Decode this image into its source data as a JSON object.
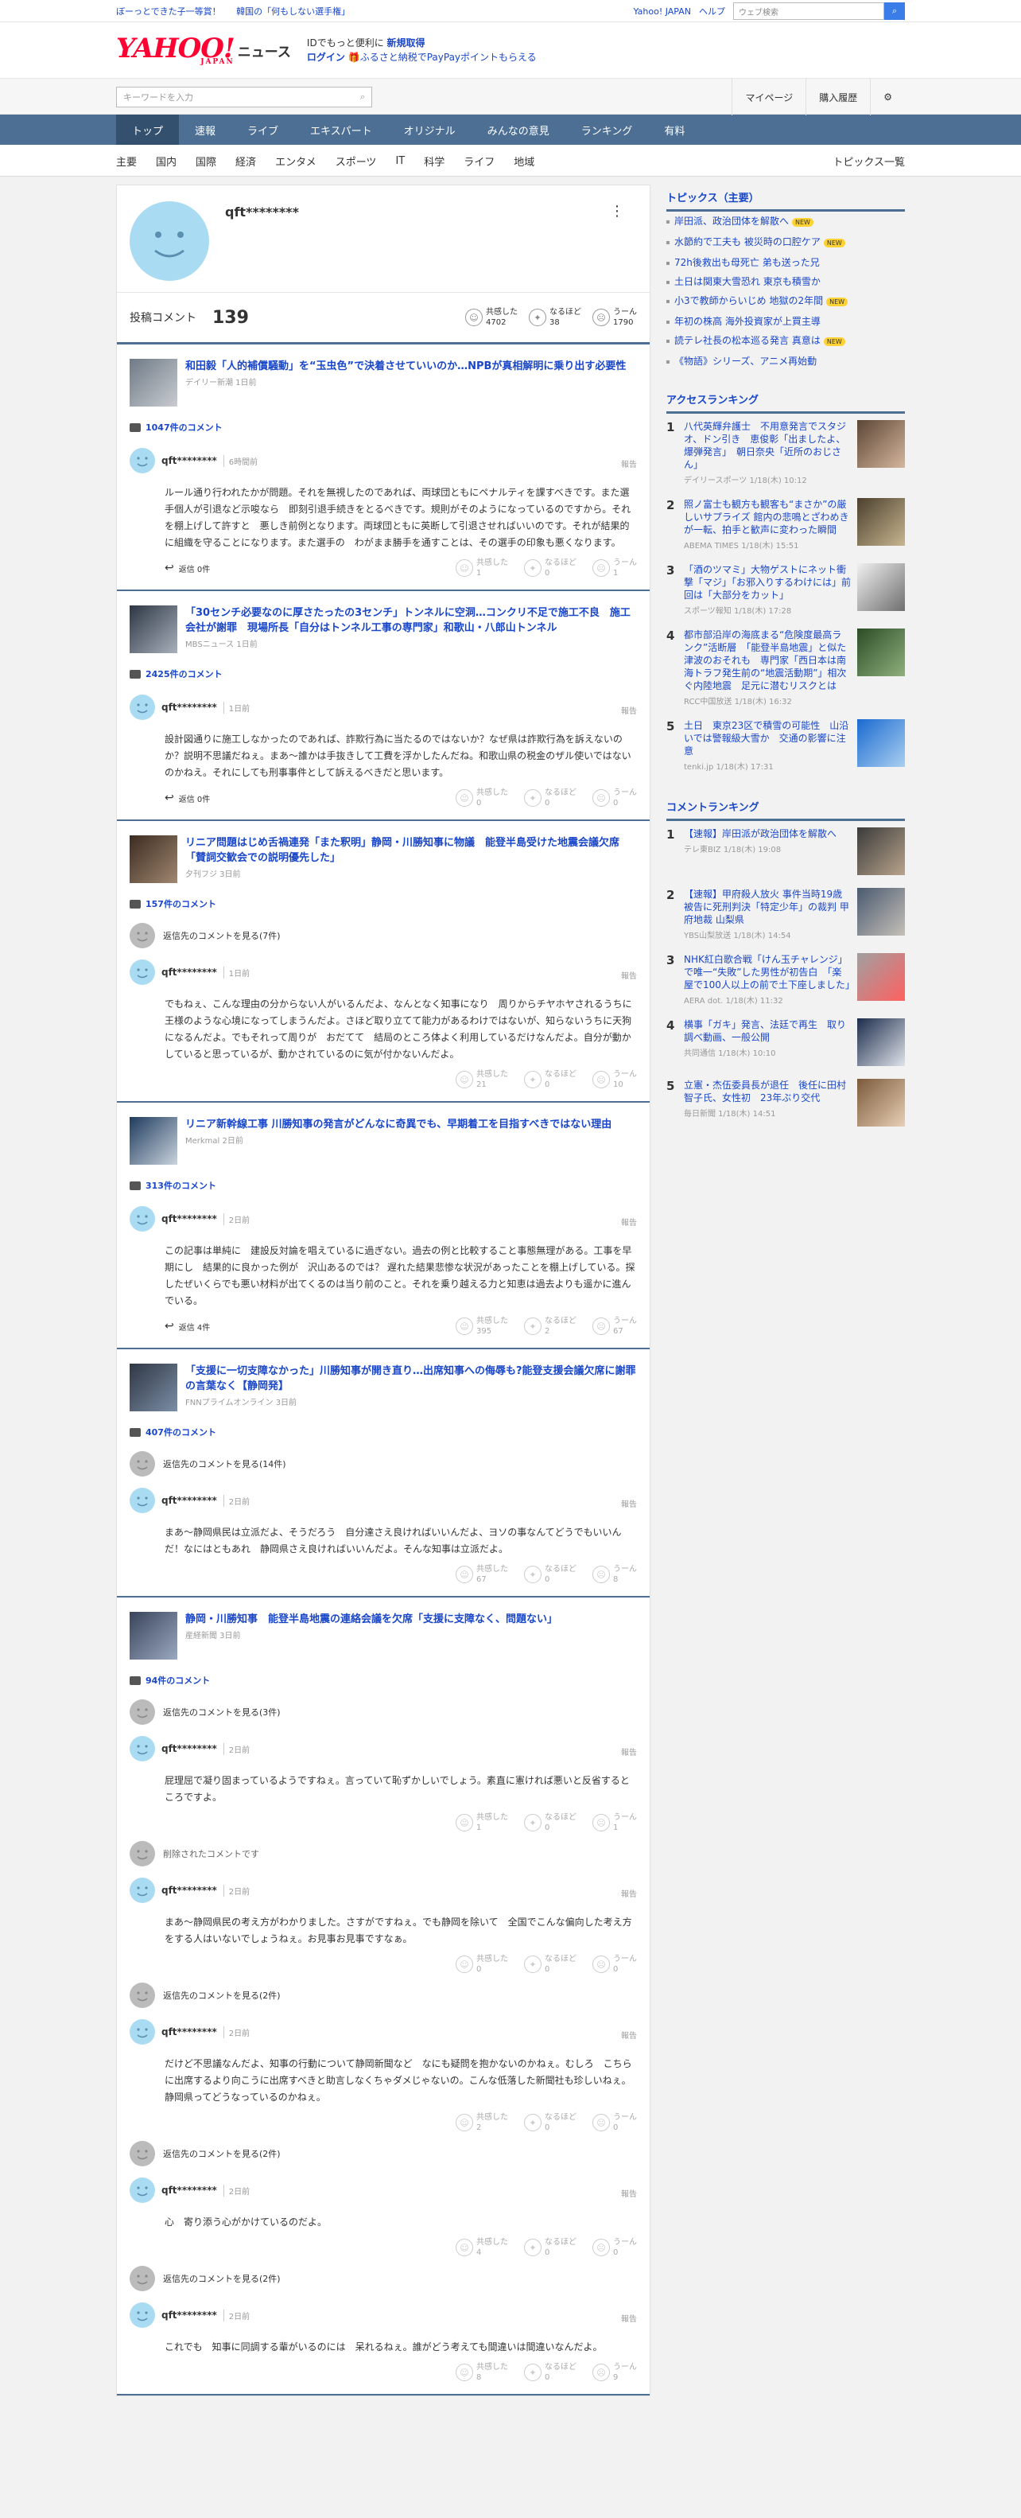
{
  "topbar": {
    "promo1": "ぼーっとできた子一等賞！",
    "promo2": "韓国の「何もしない選手権」",
    "yahoo_japan": "Yahoo! JAPAN",
    "help": "ヘルプ",
    "search_placeholder": "ウェブ検索"
  },
  "header": {
    "logo": "YAHOO!",
    "logo_sub": "JAPAN",
    "news": "ニュース",
    "line1_prefix": "IDでもっと便利に",
    "line1_link": "新規取得",
    "login": "ログイン",
    "line2": "ふるさと納税でPayPayポイントもらえる"
  },
  "search": {
    "placeholder": "キーワードを入力",
    "mypage": "マイページ",
    "purchase": "購入履歴"
  },
  "nav": [
    "トップ",
    "速報",
    "ライブ",
    "エキスパート",
    "オリジナル",
    "みんなの意見",
    "ランキング",
    "有料"
  ],
  "subnav": [
    "主要",
    "国内",
    "国際",
    "経済",
    "エンタメ",
    "スポーツ",
    "IT",
    "科学",
    "ライフ",
    "地域"
  ],
  "subnav_all": "トピックス一覧",
  "profile": {
    "name": "qft********",
    "label": "投稿コメント",
    "count": "139",
    "empathy_label": "共感した",
    "empathy": "4702",
    "naruhodo_label": "なるほど",
    "naruhodo": "38",
    "uun_label": "うーん",
    "uun": "1790"
  },
  "articles": [
    {
      "title": "和田毅「人的補償騒動」を“玉虫色”で決着させていいのか…NPBが真相解明に乗り出す必要性",
      "source": "デイリー新潮 1日前",
      "ccount": "1047件のコメント",
      "comments": [
        {
          "name": "qft********",
          "time": "6時間前",
          "body": "ルール通り行われたかが問題。それを無視したのであれば、両球団ともにペナルティを課すべきです。また選手個人が引退など示唆なら　即刻引退手続きをとるべきです。規則がそのようになっているのですから。それを棚上げして許すと　悪しき前例となります。両球団ともに英断して引退させればいいのです。それが結果的に組織を守ることになります。また選手の　わがまま勝手を通すことは、その選手の印象も悪くなります。",
          "reply": "返信 0件",
          "e": "1",
          "n": "0",
          "u": "1"
        }
      ]
    },
    {
      "title": "「30センチ必要なのに厚さたったの3センチ」トンネルに空洞…コンクリ不足で施工不良　施工会社が謝罪　現場所長「自分はトンネル工事の専門家」和歌山・八郎山トンネル",
      "source": "MBSニュース 1日前",
      "ccount": "2425件のコメント",
      "comments": [
        {
          "name": "qft********",
          "time": "1日前",
          "body": "設計図通りに施工しなかったのであれば、詐欺行為に当たるのではないか？なぜ県は詐欺行為を訴えないのか？説明不思議だねぇ。まあ〜誰かは手抜きして工費を浮かしたんだね。和歌山県の税金のザル使いではないのかねえ。それにしても刑事事件として訴えるべきだと思います。",
          "reply": "返信 0件",
          "e": "0",
          "n": "0",
          "u": "0"
        }
      ]
    },
    {
      "title": "リニア問題はじめ舌禍連発「また釈明」静岡・川勝知事に物議　能登半島受けた地震会議欠席「賛詞交歓会での説明優先した」",
      "source": "夕刊フジ 3日前",
      "ccount": "157件のコメント",
      "more": "返信先のコメントを見る(7件)",
      "comments": [
        {
          "name": "qft********",
          "time": "1日前",
          "body": "でもねぇ、こんな理由の分からない人がいるんだよ、なんとなく知事になり　周りからチヤホヤされるうちに　王様のような心境になってしまうんだよ。さほど取り立てて能力があるわけではないが、知らないうちに天狗になるんだよ。でもそれって周りが　おだてて　結局のところ体よく利用しているだけなんだよ。自分が動かしていると思っているが、動かされているのに気が付かないんだよ。",
          "reply": "",
          "e": "21",
          "n": "0",
          "u": "10"
        }
      ]
    },
    {
      "title": "リニア新幹線工事 川勝知事の発言がどんなに奇異でも、早期着工を目指すべきではない理由",
      "source": "Merkmal 2日前",
      "ccount": "313件のコメント",
      "comments": [
        {
          "name": "qft********",
          "time": "2日前",
          "body": "この記事は単純に　建設反対論を唱えているに過ぎない。過去の例と比較すること事態無理がある。工事を早期にし　結果的に良かった例が　沢山あるのでは？\n遅れた結果悲惨な状況があったことを棚上げしている。探したぜいくらでも悪い材料が出てくるのは当り前のこと。それを乗り越える力と知恵は過去よりも遥かに進んでいる。",
          "reply": "返信 4件",
          "e": "395",
          "n": "2",
          "u": "67"
        }
      ]
    },
    {
      "title": "「支援に一切支障なかった」川勝知事が開き直り…出席知事への侮辱も?能登支援会議欠席に謝罪の言葉なく【静岡発】",
      "source": "FNNプライムオンライン 3日前",
      "ccount": "407件のコメント",
      "more": "返信先のコメントを見る(14件)",
      "comments": [
        {
          "name": "qft********",
          "time": "2日前",
          "body": "まあ〜静岡県民は立派だよ、そうだろう　自分達さえ良ければいいんだよ、ヨソの事なんてどうでもいいんだ！なにはともあれ　静岡県さえ良ければいいんだよ。そんな知事は立派だよ。",
          "reply": "",
          "e": "67",
          "n": "0",
          "u": "8"
        }
      ]
    },
    {
      "title": "静岡・川勝知事　能登半島地震の連絡会議を欠席「支援に支障なく、問題ない」",
      "source": "産経新聞 3日前",
      "ccount": "94件のコメント",
      "more": "返信先のコメントを見る(3件)",
      "comments": [
        {
          "name": "qft********",
          "time": "2日前",
          "body": "屁理屈で凝り固まっているようですねぇ。言っていて恥ずかしいでしょう。素直に憲ければ悪いと反省するところですよ。",
          "reply": "",
          "e": "1",
          "n": "0",
          "u": "1"
        },
        {
          "deleted": "削除されたコメントです",
          "name": "qft********",
          "time": "2日前",
          "body": "まあ〜静岡県民の考え方がわかりました。さすがですねぇ。でも静岡を除いて　全国でこんな偏向した考え方をする人はいないでしょうねぇ。お見事お見事ですなぁ。",
          "reply": "",
          "e": "0",
          "n": "0",
          "u": "0"
        },
        {
          "more": "返信先のコメントを見る(2件)",
          "name": "qft********",
          "time": "2日前",
          "body": "だけど不思議なんだよ、知事の行動について静岡新聞など　なにも疑問を抱かないのかねぇ。むしろ　こちらに出席するより向こうに出席すべきと助言しなくちゃダメじゃないの。こんな低落した新聞社も珍しいねぇ。静岡県ってどうなっているのかねぇ。",
          "reply": "",
          "e": "2",
          "n": "0",
          "u": "0"
        },
        {
          "more": "返信先のコメントを見る(2件)",
          "name": "qft********",
          "time": "2日前",
          "body": "心　寄り添う心がかけているのだよ。",
          "reply": "",
          "e": "4",
          "n": "0",
          "u": "0"
        },
        {
          "more": "返信先のコメントを見る(2件)",
          "name": "qft********",
          "time": "2日前",
          "body": "これでも　知事に同調する輩がいるのには　呆れるねぇ。誰がどう考えても間違いは間違いなんだよ。",
          "reply": "",
          "e": "8",
          "n": "0",
          "u": "9"
        }
      ]
    }
  ],
  "side": {
    "topics_title": "トピックス（主要）",
    "topics": [
      {
        "t": "岸田派、政治団体を解散へ",
        "new": true
      },
      {
        "t": "水節約で工夫も 被災時の口腔ケア",
        "new": true
      },
      {
        "t": "72h後救出も母死亡 弟も送った兄",
        "new": false
      },
      {
        "t": "土日は関東大雪恐れ 東京も積雪か",
        "new": false
      },
      {
        "t": "小3で教師からいじめ 地獄の2年間",
        "new": true
      },
      {
        "t": "年初の株高 海外投資家が上買主導",
        "new": false
      },
      {
        "t": "読テレ社長の松本巡る発言 真意は",
        "new": true
      },
      {
        "t": "《物語》シリーズ、アニメ再始動",
        "new": false
      }
    ],
    "new_label": "NEW",
    "access_title": "アクセスランキング",
    "access": [
      {
        "n": "1",
        "t": "八代英輝弁護士　不用意発言でスタジオ、ドン引き　恵俊彰「出ましたよ、爆弾発言」　朝日奈央「近所のおじさん」",
        "s": "デイリースポーツ 1/18(木) 10:12"
      },
      {
        "n": "2",
        "t": "照ノ富士も観方も観客も“まさか”の厳しいサプライズ 館内の悲鳴とざわめきが一転、拍手と歓声に変わった瞬間",
        "s": "ABEMA TIMES 1/18(木) 15:51"
      },
      {
        "n": "3",
        "t": "「酒のツマミ」大物ゲストにネット衝撃「マジ」「お邪入りするわけには」前回は「大部分をカット」",
        "s": "スポーツ報知 1/18(木) 17:28"
      },
      {
        "n": "4",
        "t": "都市部沿岸の海底まる“危険度最高ランク”活断層　「能登半島地震」と似た津波のおそれも　専門家「西日本は南海トラフ発生前の“地震活動期”」相次ぐ内陸地震　足元に潜むリスクとは",
        "s": "RCC中国放送 1/18(木) 16:32"
      },
      {
        "n": "5",
        "t": "土日　東京23区で積雪の可能性　山沿いでは警報級大雪か　交通の影響に注意",
        "s": "tenki.jp 1/18(木) 17:31"
      }
    ],
    "comment_title": "コメントランキング",
    "commentr": [
      {
        "n": "1",
        "t": "【速報】岸田派が政治団体を解散へ",
        "s": "テレ東BIZ 1/18(木) 19:08"
      },
      {
        "n": "2",
        "t": "【速報】甲府殺人放火 事件当時19歳被告に死刑判決「特定少年」の裁判 甲府地裁 山梨県",
        "s": "YBS山梨放送 1/18(木) 14:54"
      },
      {
        "n": "3",
        "t": "NHK紅白歌合戦「けん玉チャレンジ」で唯一“失敗”した男性が初告白　「楽屋で100人以上の前で土下座しました」",
        "s": "AERA dot. 1/18(木) 11:32"
      },
      {
        "n": "4",
        "t": "横事「ガキ」発言、法廷で再生　取り調べ動画、一般公開",
        "s": "共同通信 1/18(木) 10:10"
      },
      {
        "n": "5",
        "t": "立憲・杰伍委員長が退任　後任に田村智子氏、女性初　23年ぶり交代",
        "s": "毎日新聞 1/18(木) 14:51"
      }
    ]
  },
  "labels": {
    "empathy": "共感した",
    "naruhodo": "なるほど",
    "uun": "うーん",
    "report": "報告"
  }
}
